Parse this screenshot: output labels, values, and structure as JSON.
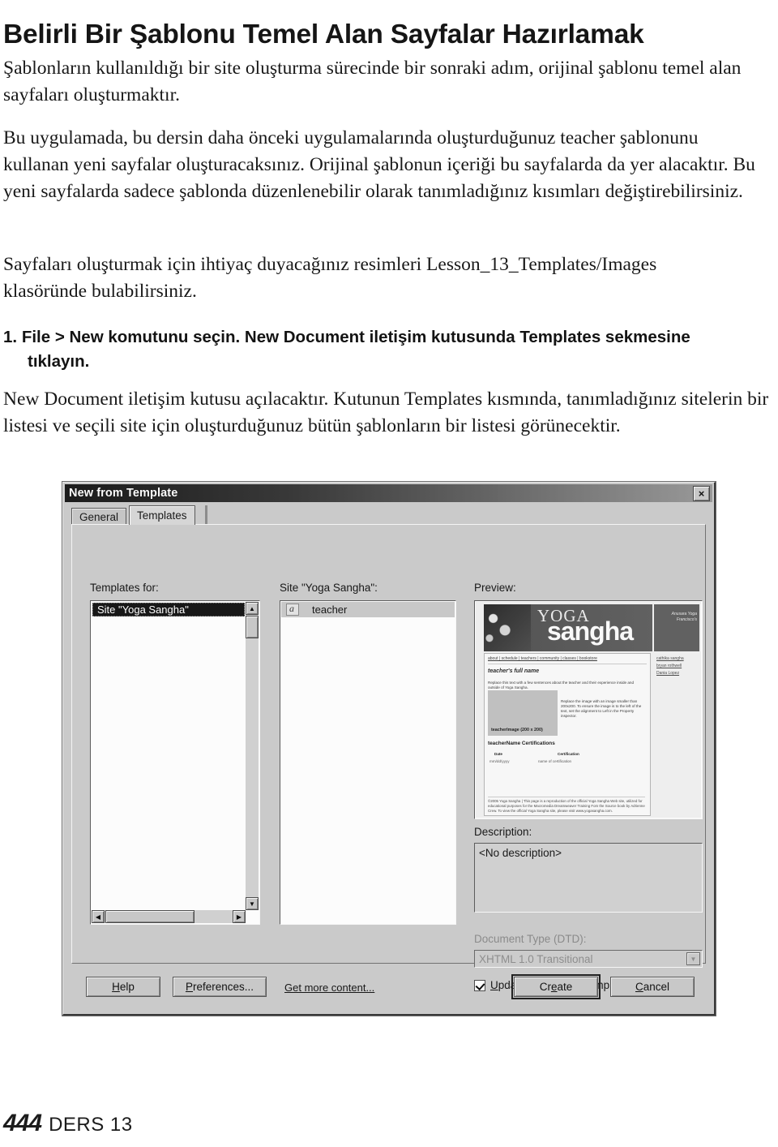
{
  "document": {
    "title": "Belirli Bir Şablonu Temel Alan Sayfalar Hazırlamak",
    "intro": "Şablonların kullanıldığı bir site oluşturma sürecinde bir sonraki adım, orijinal şablonu temel alan sayfaları oluşturmaktır.",
    "body1": "Bu uygulamada, bu dersin daha önceki uygulamalarında oluşturduğunuz teacher şablonunu kullanan yeni sayfalar oluşturacaksınız. Orijinal şablonun içeriği bu sayfalarda da yer alacaktır. Bu yeni sayfalarda sadece şablonda düzenlenebilir olarak tanımladığınız kısımları değiştirebilirsiniz.",
    "body2": "Sayfaları oluşturmak için ihtiyaç duyacağınız resimleri Lesson_13_Templates/Images klasöründe bulabilirsiniz.",
    "body3": "New Document iletişim kutusu açılacaktır. Kutunun Templates kısmında, tanımladığınız sitelerin bir listesi ve seçili site için oluşturduğunuz bütün şablonların bir listesi görünecektir.",
    "step1": {
      "number": "1.",
      "text": "File > New komutunu seçin. New Document iletişim kutusunda Templates sekmesine tıklayın."
    }
  },
  "footer": {
    "page_number": "444",
    "lesson_label": "DERS 13"
  },
  "dialog": {
    "title": "New from Template",
    "close_label": "×",
    "tabs": [
      {
        "label": "General",
        "active": false
      },
      {
        "label": "Templates",
        "active": true
      }
    ],
    "templates_for": {
      "label": "Templates for:",
      "selected_item": "Site \"Yoga Sangha\""
    },
    "site_list": {
      "label": "Site \"Yoga Sangha\":",
      "items": [
        {
          "name": "teacher",
          "icon": "template-file-icon"
        }
      ]
    },
    "preview": {
      "label": "Preview:",
      "site": {
        "logo_line1": "YOGA",
        "logo_line2": "sangha",
        "tagline": "Anusara Yoga Francisco's",
        "side_links": [
          "cathika sangha",
          "bryan rothwell",
          "Dania Lopez"
        ],
        "nav": "about | schedule | teachers | community | classes | bookstore",
        "heading": "teacher's full name",
        "paragraph1": "Replace this text with a few sentences about the teacher and their experience inside and outside of Yoga Sangha.",
        "image_placeholder": "teacherImage (200 x 200)",
        "paragraph2": "Replace the image with an image smaller than 200x200. To ensure the image is to the left of the text, set the alignment to Left in the Property inspector.",
        "table_heading": "teacherName Certifications",
        "table_headers": [
          "Date",
          "Certification"
        ],
        "table_row": [
          "mm/dd/yyyy",
          "name of certification"
        ],
        "footer_text": "©2005 Yoga Sangha | This page is a reproduction of the official Yoga Sangha Web site, utilized for educational purposes for the Macromedia Dreamweaver Training Fom the Source book by Adrienne Crew. To view the official Yoga Sangha site, please visit www.yogasangha.com."
      }
    },
    "description": {
      "label": "Description:",
      "value": "<No description>"
    },
    "document_type": {
      "label": "Document Type (DTD):",
      "value": "XHTML 1.0 Transitional",
      "arrow": "▼"
    },
    "update_checkbox": {
      "label_prefix": "U",
      "label_rest": "pdate page when template changes",
      "checked": true
    },
    "buttons": {
      "help": {
        "prefix": "H",
        "rest": "elp"
      },
      "preferences": {
        "prefix": "P",
        "rest": "references..."
      },
      "get_more_content": "Get more content...",
      "create": {
        "prefix": "Cr",
        "mid": "e",
        "rest": "ate"
      },
      "cancel": {
        "prefix": "C",
        "rest": "ancel"
      }
    },
    "scroll": {
      "up_arrow": "▲",
      "down_arrow": "▼",
      "left_arrow": "◀",
      "right_arrow": "▶"
    }
  }
}
